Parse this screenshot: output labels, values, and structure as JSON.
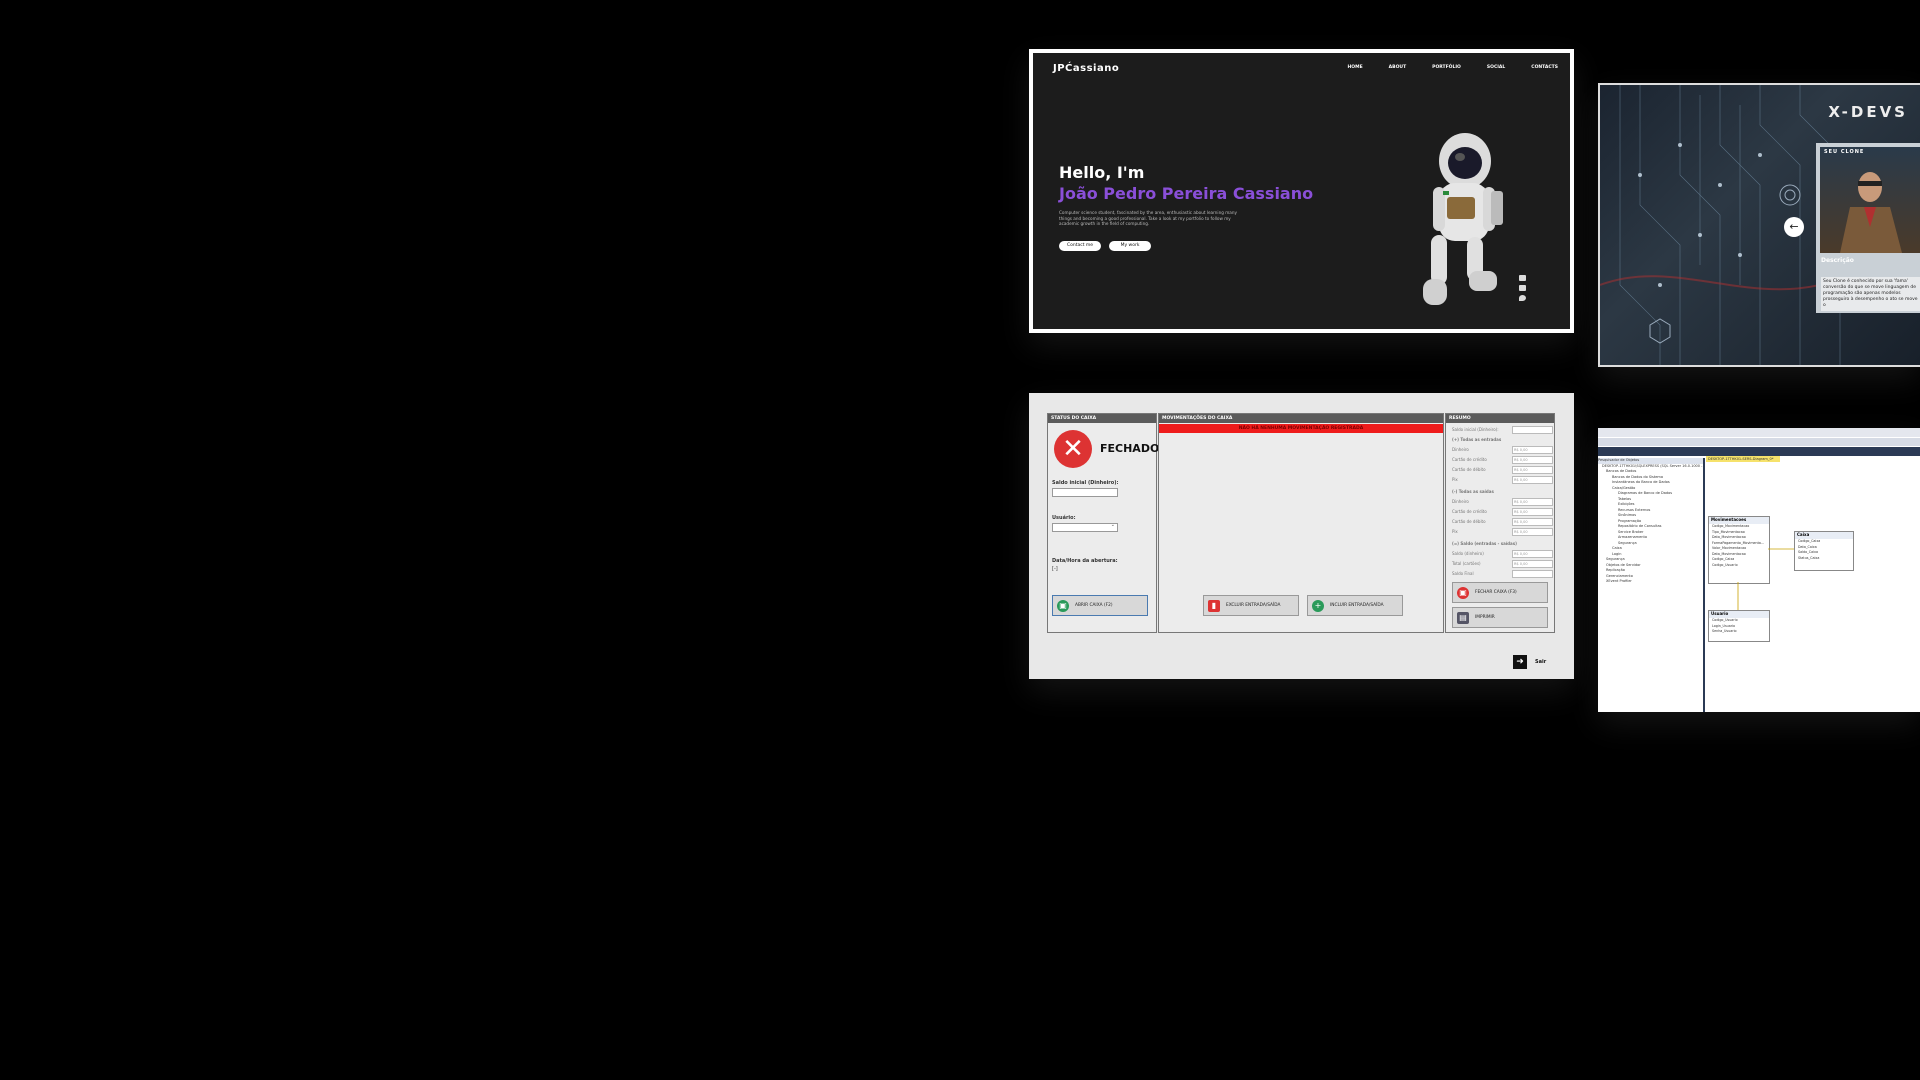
{
  "portfolio": {
    "logo": "JPĆassiano",
    "nav": [
      "HOME",
      "ABOUT",
      "PORTFÓLIO",
      "SOCIAL",
      "CONTACTS"
    ],
    "hello": "Hello, I'm",
    "name": "João Pedro Pereira Cassiano",
    "description": "Computer science student, fascinated by the area, enthusiastic about learning many things and becoming a good professional. Take a look at my portfolio to follow my academic growth in the field of computing.",
    "contact_btn": "Contact me",
    "work_btn": "My work",
    "accent": "#8a4fd8"
  },
  "xdevs": {
    "title": "X-DEVS",
    "clone_label": "SEU CLONE",
    "desc_title": "Descrição",
    "desc_text": "Seu Clone é conhecido por sua 'fama' conversão do que se move linguagem de programação são apenas modelos prosseguiro à desempenho o ato se move o"
  },
  "caixa": {
    "status_header": "STATUS DO CAIXA",
    "status_text": "FECHADO",
    "saldo_label": "Saldo inicial (Dinheiro):",
    "usuario_label": "Usuário:",
    "abertura_label": "Data/Hora da abertura:",
    "abertura_value": "[-]",
    "abrir_btn": "ABRIR CAIXA (F2)",
    "mov_header": "MOVIMENTAÇÕES DO CAIXA",
    "mov_banner": "NÃO HÁ NENHUMA MOVIMENTAÇÃO REGISTRADA",
    "excluir_btn": "EXCLUIR ENTRADA/SAÍDA",
    "incluir_btn": "INCLUIR ENTRADA/SAÍDA",
    "resumo_header": "RESUMO",
    "resumo_saldo": "Saldo inicial (Dinheiro):",
    "entradas_title": "(+) Todas as entradas",
    "saidas_title": "(-) Todas as saídas",
    "saldo_title": "(=) Saldo (entradas - saídas)",
    "rows_money": [
      "Dinheiro",
      "Cartão de crédito",
      "Cartão de débito",
      "Pix"
    ],
    "rows_saldo": [
      "Saldo (dinheiro)",
      "Total (cartões)",
      "Saldo Final"
    ],
    "money_value": "R$ 0,00",
    "fechar_btn": "FECHAR CAIXA (F3)",
    "imprimir_btn": "IMPRIMIR",
    "sair": "Sair"
  },
  "ssms": {
    "tab": "DESKTOP-1TTHK01-SERS-Diagram_0*",
    "tree": [
      "Pesquisador de Objetos",
      "DESKTOP-1TTHK01\\SQLEXPRESS (SQL Server 16.0.1000 -",
      "Bancos de Dados",
      "Bancos de Dados do Sistema",
      "Instantâneos do Banco de Dados",
      "Caixa/Gestão",
      "Diagramas de Banco de Dados",
      "Tabelas",
      "Exibições",
      "Recursos Externos",
      "Sinônimos",
      "Programação",
      "Repositório de Consultas",
      "Service Broker",
      "Armazenamento",
      "Segurança",
      "Caixa",
      "Login",
      "Segurança",
      "Objetos de Servidor",
      "Replicação",
      "Gerenciamento",
      "XEvent Profiler"
    ],
    "table_mov": {
      "title": "Movimentacoes",
      "rows": [
        "Codigo_Movimentacao",
        "Tipo_Movimentacao",
        "Data_Movimentacao",
        "FormaPagamento_Movimenta...",
        "Valor_Movimentacao",
        "Data_Movimentacao",
        "Codigo_Caixa",
        "Codigo_Usuario"
      ]
    },
    "table_caixa": {
      "title": "Caixa",
      "rows": [
        "Codigo_Caixa",
        "Data_Caixa",
        "Saldo_Caixa",
        "Status_Caixa"
      ]
    },
    "table_usuario": {
      "title": "Usuario",
      "rows": [
        "Codigo_Usuario",
        "Login_Usuario",
        "Senha_Usuario"
      ]
    }
  }
}
